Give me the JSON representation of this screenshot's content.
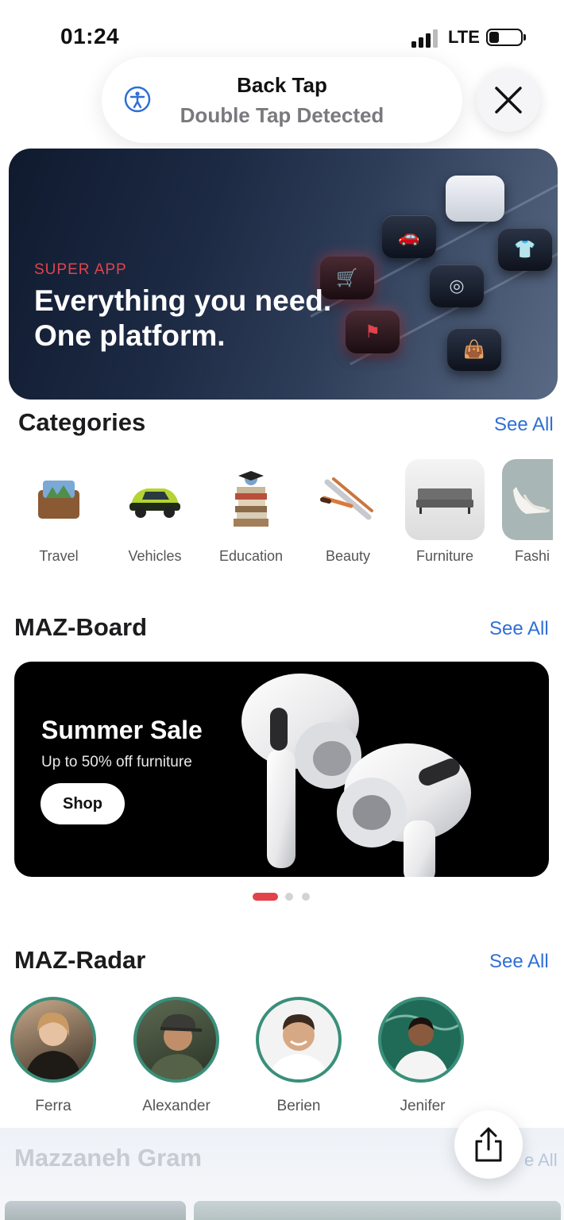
{
  "status_bar": {
    "time": "01:24",
    "network": "LTE"
  },
  "back_tap": {
    "title": "Back Tap",
    "subtitle": "Double Tap Detected"
  },
  "hero": {
    "eyebrow": "SUPER APP",
    "title_line1": "Everything you need.",
    "title_line2": "One platform."
  },
  "categories": {
    "title": "Categories",
    "see_all": "See All",
    "items": [
      {
        "label": "Travel",
        "icon": "suitcase-icon"
      },
      {
        "label": "Vehicles",
        "icon": "car-icon"
      },
      {
        "label": "Education",
        "icon": "books-icon"
      },
      {
        "label": "Beauty",
        "icon": "brushes-icon"
      },
      {
        "label": "Furniture",
        "icon": "sofa-icon"
      },
      {
        "label": "Fashi",
        "icon": "heels-icon"
      }
    ]
  },
  "board": {
    "title": "MAZ-Board",
    "see_all": "See All",
    "slide": {
      "title": "Summer Sale",
      "subtitle": "Up to 50% off furniture",
      "button": "Shop"
    },
    "pager": {
      "count": 3,
      "active": 0
    }
  },
  "radar": {
    "title": "MAZ-Radar",
    "see_all": "See All",
    "people": [
      {
        "name": "Ferra"
      },
      {
        "name": "Alexander"
      },
      {
        "name": "Berien"
      },
      {
        "name": "Jenifer"
      }
    ]
  },
  "gram": {
    "title": "Mazzaneh Gram",
    "see_all": "e All"
  },
  "colors": {
    "accent": "#2f6fd6",
    "brand_red": "#e2434b",
    "ring": "#3a8f7a"
  }
}
